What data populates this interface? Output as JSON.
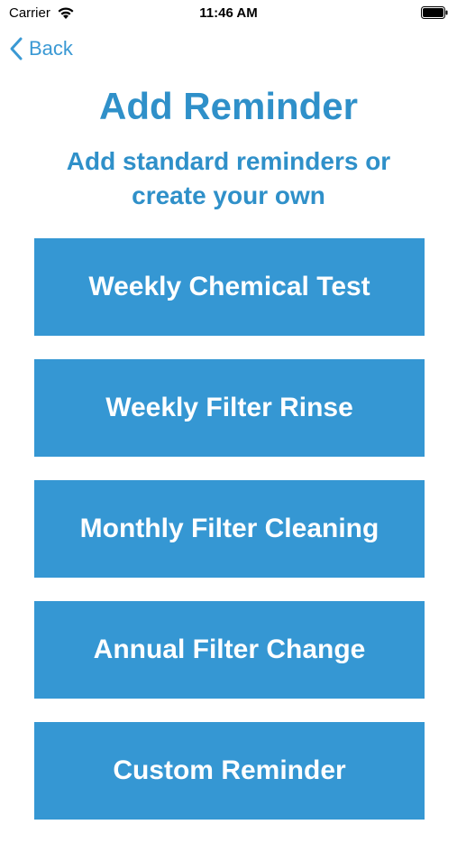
{
  "status_bar": {
    "carrier": "Carrier",
    "time": "11:46 AM"
  },
  "nav": {
    "back_label": "Back"
  },
  "header": {
    "title": "Add Reminder",
    "subtitle": "Add standard reminders or create your own"
  },
  "reminders": [
    {
      "label": "Weekly Chemical Test"
    },
    {
      "label": "Weekly Filter Rinse"
    },
    {
      "label": "Monthly Filter Cleaning"
    },
    {
      "label": "Annual Filter Change"
    },
    {
      "label": "Custom Reminder"
    }
  ],
  "colors": {
    "accent": "#2f90c9",
    "button": "#3597d3",
    "button_text": "#ffffff"
  },
  "icons": {
    "wifi": "wifi-icon",
    "battery": "battery-icon",
    "back": "chevron-left-icon"
  }
}
